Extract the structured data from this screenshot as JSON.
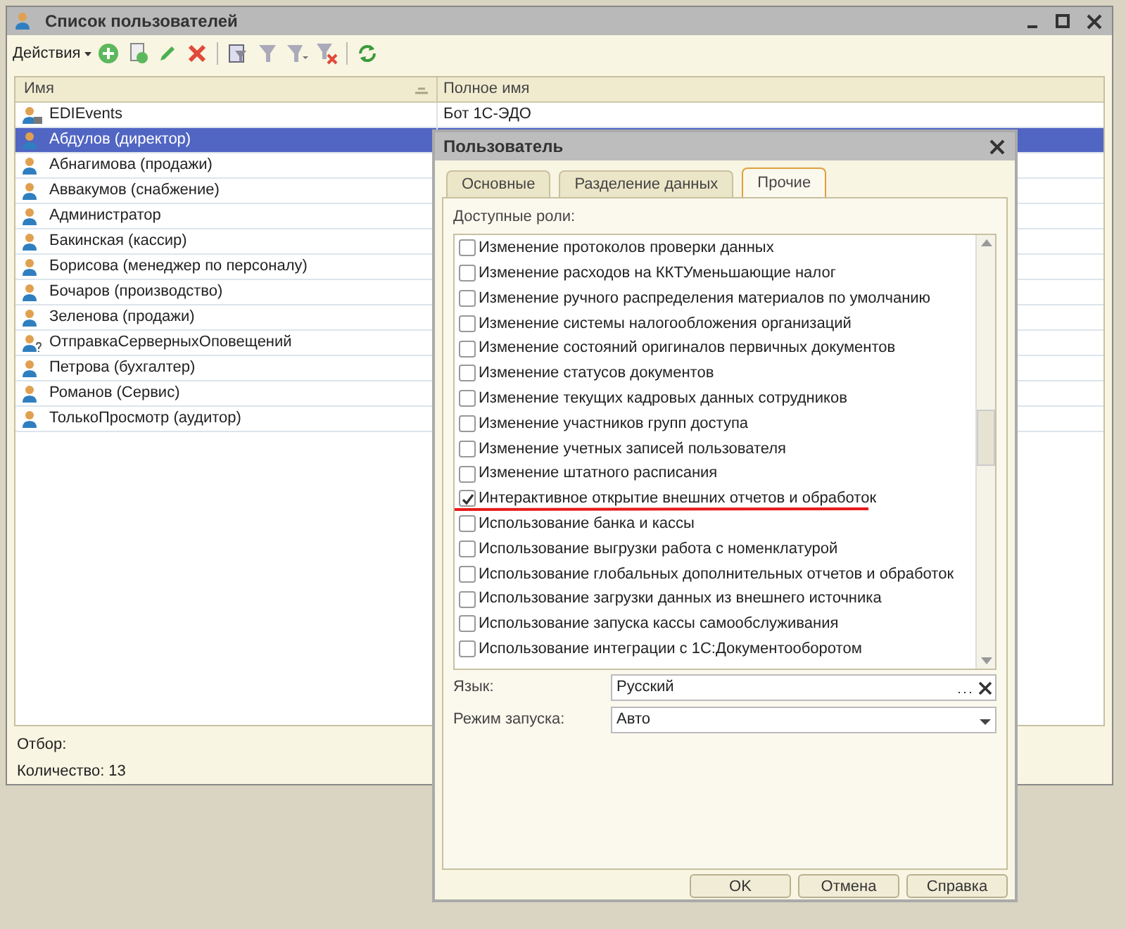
{
  "window": {
    "title": "Список пользователей"
  },
  "toolbar": {
    "actions_label": "Действия"
  },
  "table": {
    "columns": [
      "Имя",
      "Полное имя"
    ],
    "rows": [
      {
        "kind": "locked",
        "name": "EDIEvents",
        "full_name": "Бот 1С-ЭДО",
        "selected": false
      },
      {
        "kind": "user",
        "name": "Абдулов (директор)",
        "selected": true
      },
      {
        "kind": "user",
        "name": "Абнагимова (продажи)",
        "selected": false
      },
      {
        "kind": "user",
        "name": "Аввакумов (снабжение)",
        "selected": false
      },
      {
        "kind": "user",
        "name": "Администратор",
        "selected": false
      },
      {
        "kind": "user",
        "name": "Бакинская (кассир)",
        "selected": false
      },
      {
        "kind": "user",
        "name": "Борисова (менеджер по персоналу)",
        "selected": false
      },
      {
        "kind": "user",
        "name": "Бочаров (производство)",
        "selected": false
      },
      {
        "kind": "user",
        "name": "Зеленова (продажи)",
        "selected": false
      },
      {
        "kind": "unknown",
        "name": "ОтправкаСерверныхОповещений",
        "selected": false
      },
      {
        "kind": "user",
        "name": "Петрова (бухгалтер)",
        "selected": false
      },
      {
        "kind": "user",
        "name": "Романов (Сервис)",
        "selected": false
      },
      {
        "kind": "user",
        "name": "ТолькоПросмотр (аудитор)",
        "selected": false
      }
    ]
  },
  "footer": {
    "filter_label": "Отбор:",
    "count": "Количество: 13"
  },
  "dialog": {
    "title": "Пользователь",
    "tabs": [
      {
        "label": "Основные",
        "selected": false
      },
      {
        "label": "Разделение данных",
        "selected": false
      },
      {
        "label": "Прочие",
        "selected": true
      }
    ],
    "roles_label": "Доступные роли:",
    "roles": [
      {
        "label": "Изменение протоколов проверки данных",
        "checked": false
      },
      {
        "label": "Изменение расходов на ККТУменьшающие налог",
        "checked": false
      },
      {
        "label": "Изменение ручного распределения материалов по умолчанию",
        "checked": false
      },
      {
        "label": "Изменение системы налогообложения организаций",
        "checked": false
      },
      {
        "label": "Изменение состояний оригиналов первичных документов",
        "checked": false
      },
      {
        "label": "Изменение статусов документов",
        "checked": false
      },
      {
        "label": "Изменение текущих кадровых данных сотрудников",
        "checked": false
      },
      {
        "label": "Изменение участников групп доступа",
        "checked": false
      },
      {
        "label": "Изменение учетных записей пользователя",
        "checked": false
      },
      {
        "label": "Изменение штатного расписания",
        "checked": false
      },
      {
        "label": "Интерактивное открытие внешних отчетов и обработок",
        "checked": true,
        "underlined": true
      },
      {
        "label": "Использование банка и кассы",
        "checked": false
      },
      {
        "label": "Использование выгрузки работа с номенклатурой",
        "checked": false
      },
      {
        "label": "Использование глобальных дополнительных отчетов и обработок",
        "checked": false
      },
      {
        "label": "Использование загрузки данных из внешнего источника",
        "checked": false
      },
      {
        "label": "Использование запуска кассы самообслуживания",
        "checked": false
      },
      {
        "label": "Использование интеграции с 1С:Документооборотом",
        "checked": false
      }
    ],
    "language": {
      "label": "Язык:",
      "value": "Русский"
    },
    "launch_mode": {
      "label": "Режим запуска:",
      "value": "Авто"
    },
    "buttons": [
      "OK",
      "Отмена",
      "Справка"
    ]
  }
}
